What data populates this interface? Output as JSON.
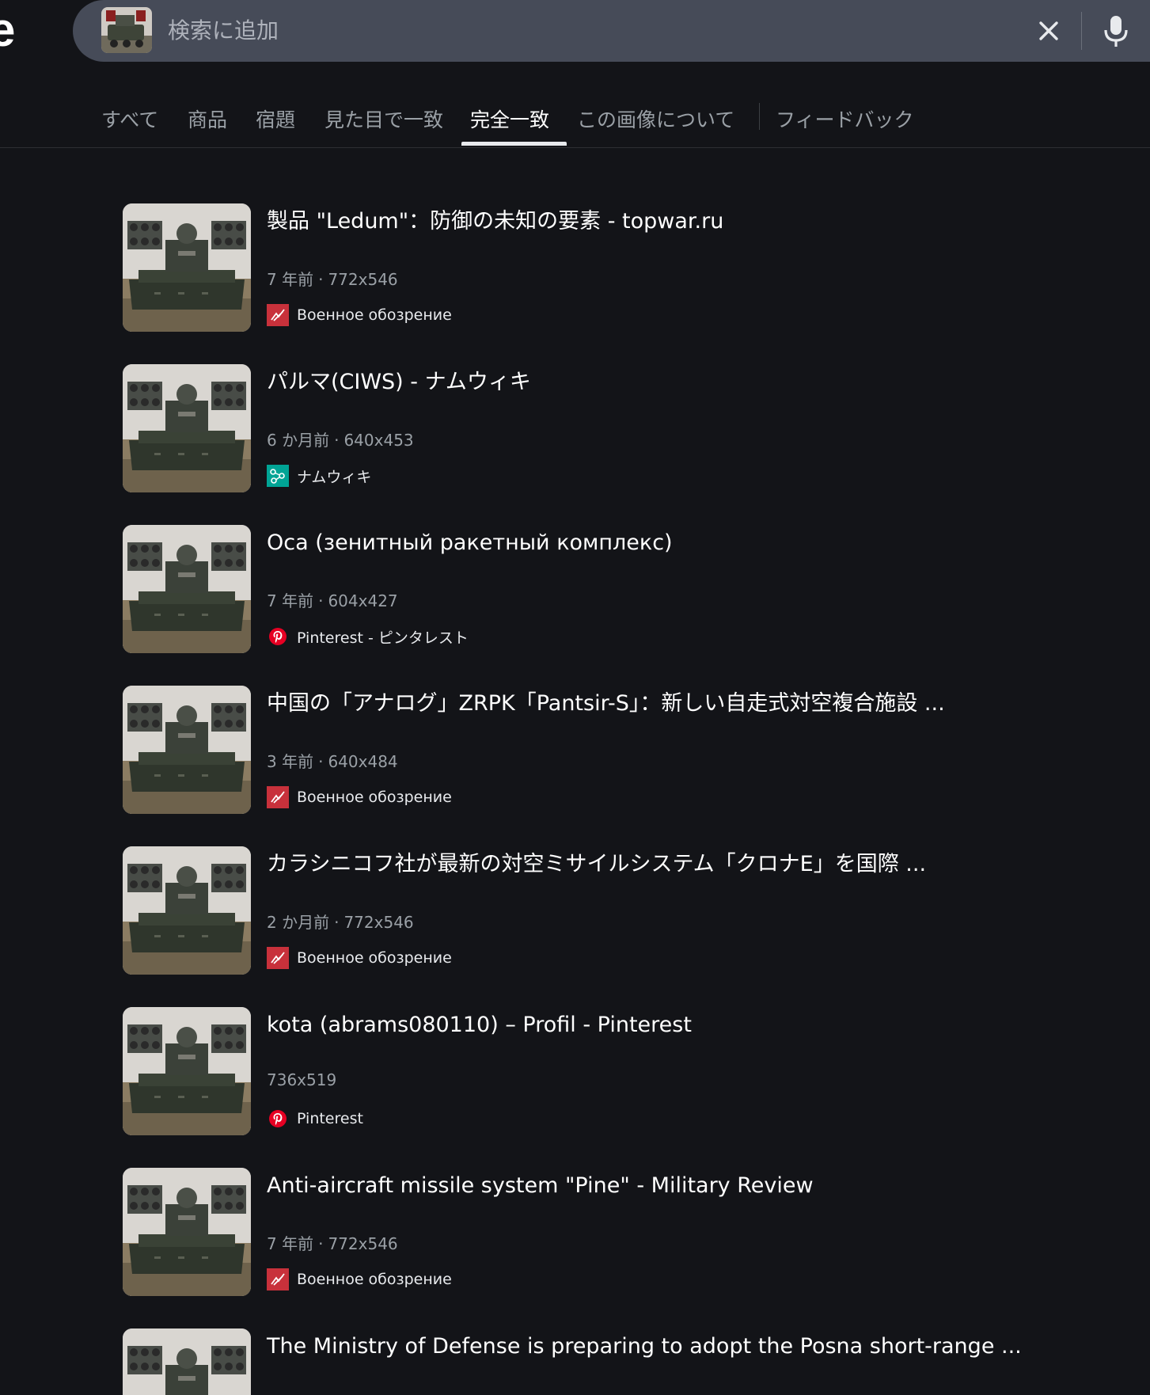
{
  "header": {
    "logo_text": "e"
  },
  "search": {
    "placeholder": "検索に追加"
  },
  "tabs": [
    {
      "label": "すべて"
    },
    {
      "label": "商品"
    },
    {
      "label": "宿題"
    },
    {
      "label": "見た目で一致"
    },
    {
      "label": "完全一致",
      "active": true
    },
    {
      "label": "この画像について"
    },
    {
      "label": "フィードバック"
    }
  ],
  "results": [
    {
      "title": "製品 \"Ledum\"：防御の未知の要素 - topwar.ru",
      "age": "7 年前",
      "size": "772x546",
      "source": "Военное обозрение",
      "source_icon": "topwar-icon"
    },
    {
      "title": "パルマ(CIWS) - ナムウィキ",
      "age": "6 か月前",
      "size": "640x453",
      "source": "ナムウィキ",
      "source_icon": "namuwiki-icon"
    },
    {
      "title": "Оса (зенитный ракетный комплекс)",
      "age": "7 年前",
      "size": "604x427",
      "source": "Pinterest - ピンタレスト",
      "source_icon": "pinterest-icon"
    },
    {
      "title": "中国の「アナログ」ZRPK「Pantsir-S」：新しい自走式対空複合施設 ...",
      "age": "3 年前",
      "size": "640x484",
      "source": "Военное обозрение",
      "source_icon": "topwar-icon"
    },
    {
      "title": "カラシニコフ社が最新の対空ミサイルシステム「クロナE」を国際 ...",
      "age": "2 か月前",
      "size": "772x546",
      "source": "Военное обозрение",
      "source_icon": "topwar-icon"
    },
    {
      "title": "kota (abrams080110) – Profil - Pinterest",
      "age": "",
      "size": "736x519",
      "source": "Pinterest",
      "source_icon": "pinterest-icon"
    },
    {
      "title": "Anti-aircraft missile system \"Pine\" - Military Review",
      "age": "7 年前",
      "size": "772x546",
      "source": "Военное обозрение",
      "source_icon": "topwar-icon"
    },
    {
      "title": "The Ministry of Defense is preparing to adopt the Posna short-range ...",
      "age": "",
      "size": "",
      "source": "",
      "source_icon": ""
    }
  ],
  "colors": {
    "background": "#131418",
    "searchbar": "#464b58",
    "topwar_red": "#c8313b",
    "namuwiki_green": "#00a495",
    "pinterest_red": "#e60023"
  }
}
